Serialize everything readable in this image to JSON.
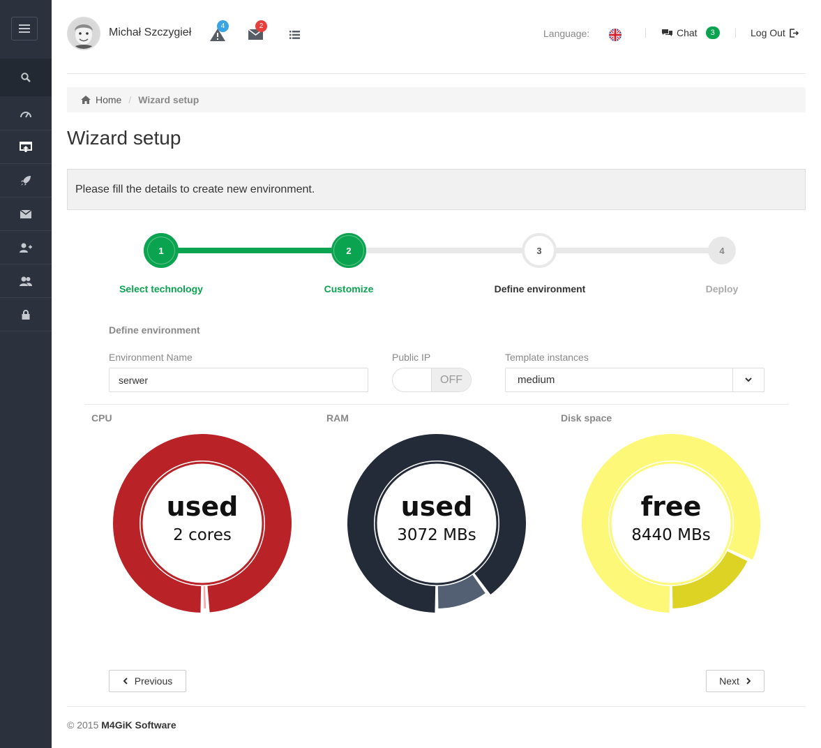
{
  "user": {
    "name": "Michał Szczygieł"
  },
  "header": {
    "alerts_count": "4",
    "messages_count": "2",
    "language_label": "Language:",
    "chat_label": "Chat",
    "chat_count": "3",
    "logout_label": "Log Out"
  },
  "sidebar": {
    "items": [
      {
        "icon": "search-icon"
      },
      {
        "icon": "dashboard-icon"
      },
      {
        "icon": "upload-window-icon"
      },
      {
        "icon": "rocket-icon"
      },
      {
        "icon": "envelope-icon"
      },
      {
        "icon": "add-user-icon"
      },
      {
        "icon": "users-icon"
      },
      {
        "icon": "lock-icon"
      }
    ]
  },
  "breadcrumb": {
    "home": "Home",
    "current": "Wizard setup"
  },
  "page": {
    "title": "Wizard setup",
    "notice": "Please fill the details to create new environment."
  },
  "steps": [
    {
      "num": "1",
      "label": "Select technology",
      "state": "done"
    },
    {
      "num": "2",
      "label": "Customize",
      "state": "done"
    },
    {
      "num": "3",
      "label": "Define environment",
      "state": "active"
    },
    {
      "num": "4",
      "label": "Deploy",
      "state": "pending"
    }
  ],
  "form": {
    "section_title": "Define environment",
    "env_name_label": "Environment Name",
    "env_name_value": "serwer",
    "public_ip_label": "Public IP",
    "public_ip_state": "OFF",
    "template_label": "Template instances",
    "template_value": "medium"
  },
  "gauges": [
    {
      "label": "CPU",
      "big": "used",
      "small": "2 cores",
      "main_color": "#b92227",
      "rest_color": "#f7a5a5",
      "fraction": 0.99
    },
    {
      "label": "RAM",
      "big": "used",
      "small": "3072 MBs",
      "main_color": "#232b38",
      "rest_color": "#536073",
      "fraction": 0.9
    },
    {
      "label": "Disk space",
      "big": "free",
      "small": "8440 MBs",
      "main_color": "#fdf877",
      "rest_color": "#dcd325",
      "fraction": 0.82
    }
  ],
  "pager": {
    "previous": "Previous",
    "next": "Next"
  },
  "footer": {
    "copyright": "© 2015",
    "company": "M4GiK Software"
  },
  "colors": {
    "sidebar_bg": "#2b323d",
    "success": "#0aa34f",
    "alert_badge": "#3aa3e3",
    "mail_badge": "#e8403d"
  }
}
